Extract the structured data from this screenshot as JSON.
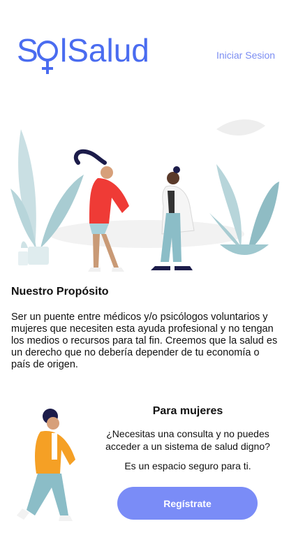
{
  "header": {
    "logo_text": "SolSalud",
    "login_link": "Iniciar Sesion"
  },
  "purpose": {
    "title": "Nuestro Propósito",
    "text": "Ser un puente entre médicos y/o psicólogos voluntarios y mujeres que necesiten esta ayuda profesional y no tengan los medios o recursos para tal fin. Creemos que la salud es un derecho que no debería depender de tu economía o país de origen."
  },
  "women": {
    "title": "Para mujeres",
    "question": "¿Necesitas una consulta y no puedes acceder a un sistema de salud digno?",
    "safe_space": "Es un espacio seguro para ti.",
    "register_button": "Regístrate"
  },
  "colors": {
    "brand": "#4a6cf0",
    "accent": "#7a8cf7",
    "link": "#7b8df2",
    "plant": "#9fc8cf"
  }
}
